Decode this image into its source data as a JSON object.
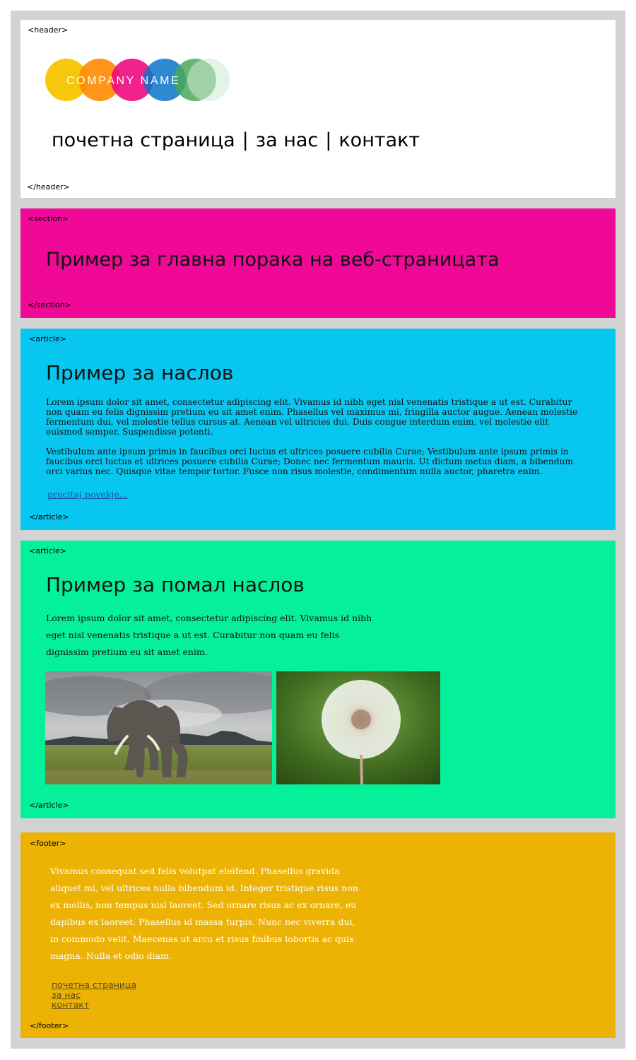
{
  "header": {
    "open_tag": "<header>",
    "close_tag": "</header>",
    "logo_text": "COMPANY NAME",
    "nav": [
      "почетна страница",
      "за нас",
      "контакт"
    ],
    "nav_separator": "|"
  },
  "section": {
    "open_tag": "<section>",
    "close_tag": "</section>",
    "main_message": "Пример за главна порака на веб-страницата"
  },
  "article1": {
    "open_tag": "<article>",
    "close_tag": "</article>",
    "heading": "Пример за наслов",
    "paragraph1": "Lorem ipsum dolor sit amet, consectetur adipiscing elit. Vivamus id nibh eget nisl venenatis tristique a ut est. Curabitur non quam eu felis dignissim pretium eu sit amet enim. Phasellus vel maximus mi, fringilla auctor augue. Aenean molestie fermentum dui, vel molestie tellus cursus at. Aenean vel ultricies dui. Duis congue interdum enim, vel molestie elit euismod semper. Suspendisse potenti.",
    "paragraph2": "Vestibulum ante ipsum primis in faucibus orci luctus et ultrices posuere cubilia Curae; Vestibulum ante ipsum primis in faucibus orci luctus et ultrices posuere cubilia Curae; Donec nec fermentum mauris. Ut dictum metus diam, a bibendum orci varius nec. Quisque vitae tempor tortor. Fusce non risus molestie, condimentum nulla auctor, pharetra enim.",
    "read_more": "procitaj povekje..."
  },
  "article2": {
    "open_tag": "<article>",
    "close_tag": "</article>",
    "heading": "Пример за помал наслов",
    "paragraph": "Lorem ipsum dolor sit amet, consectetur adipiscing elit. Vivamus id nibh eget nisl venenatis tristique a ut est. Curabitur non quam eu felis dignissim pretium eu sit amet enim."
  },
  "footer": {
    "open_tag": "<footer>",
    "close_tag": "</footer>",
    "text": "Vivamus consequat sed felis volutpat eleifend. Phasellus gravida aliquet mi, vel ultrices nulla bibendum id. Integer tristique risus non ex mollis, non tempus nisl laoreet. Sed ornare risus ac ex ornare, eu dapibus ex laoreet. Phasellus id massa turpis. Nunc nec viverra dui, in commodo velit. Maecenas ut arcu et risus finibus lobortis ac quis magna. Nulla et odio diam.",
    "links": [
      "почетна страница",
      "за нас",
      "контакт"
    ]
  },
  "colors": {
    "frame": "#d3d3d3",
    "header_bg": "#ffffff",
    "section_bg": "#f00996",
    "article1_bg": "#07c6ef",
    "article2_bg": "#05f09b",
    "footer_bg": "#edb304",
    "logo_circles": [
      "#f5c400",
      "#ff8a00",
      "#ee0a7e",
      "#0a74c8",
      "#4aa85c",
      "#cfe9d4"
    ]
  },
  "icons": {
    "logo": "company-logo-circles",
    "photo1": "elephant-photo",
    "photo2": "dandelion-photo"
  }
}
